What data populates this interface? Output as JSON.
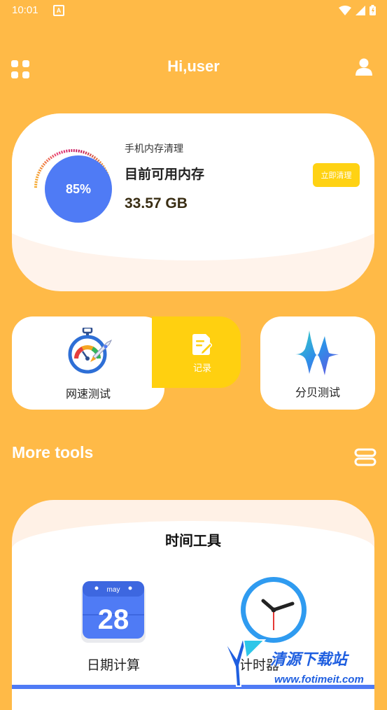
{
  "status_bar": {
    "time": "10:01",
    "notif_letter": "A"
  },
  "header": {
    "greeting": "Hi,user"
  },
  "memory_card": {
    "percent_label": "85%",
    "percent_value": 85,
    "label": "手机内存清理",
    "title": "目前可用内存",
    "value": "33.57 GB",
    "clean_button": "立即清理"
  },
  "tools": {
    "speed_test": "网速测试",
    "record": "记录",
    "decibel_test": "分贝测试"
  },
  "more_tools": {
    "title": "More tools"
  },
  "time_tools": {
    "title": "时间工具",
    "calendar_month": "may",
    "calendar_day": "28",
    "date_calc": "日期计算",
    "timer": "计时器"
  },
  "watermark": {
    "text": "清源下载站",
    "url": "www.fotimeit.com"
  },
  "colors": {
    "background": "#FFBA47",
    "accent_blue": "#4F7BF5",
    "accent_yellow": "#FFD010"
  }
}
